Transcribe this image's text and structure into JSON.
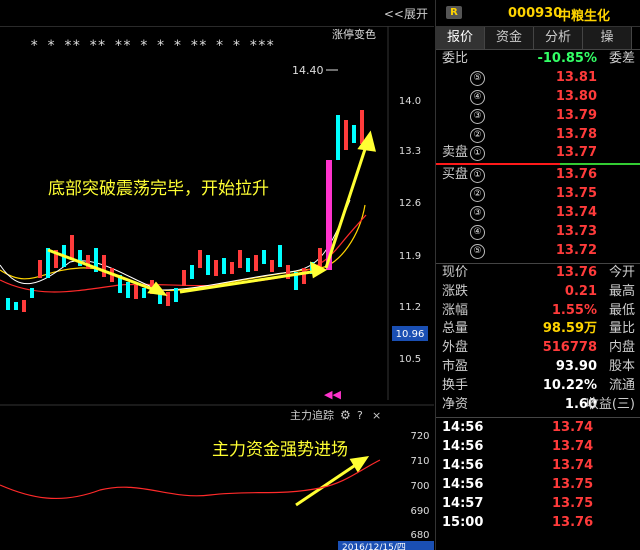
{
  "chart": {
    "expand_label": "<<展开",
    "limit_label": "涨停变色",
    "high_label": "14.40",
    "annotation_1": "底部突破震荡完毕，开始拉升",
    "annotation_2": "主力资金强势进场",
    "sub_title": "主力追踪",
    "price_axis": [
      "14.0",
      "13.3",
      "12.6",
      "11.9",
      "11.2",
      "10.96",
      "10.5"
    ],
    "sub_axis": [
      "720",
      "710",
      "700",
      "690",
      "680"
    ],
    "date_label": "2016/12/15/四",
    "star_marks": "* *  ** **   **   * *  * **     *   * ***"
  },
  "header": {
    "badge": "R",
    "code": "000930",
    "name": "中粮生化"
  },
  "tabs": [
    "报价",
    "资金",
    "分析",
    "操"
  ],
  "weibi": {
    "label": "委比",
    "value": "-10.85%",
    "label2": "委差"
  },
  "sell": [
    {
      "num": "⑤",
      "price": "13.81"
    },
    {
      "num": "④",
      "price": "13.80"
    },
    {
      "num": "③",
      "price": "13.79"
    },
    {
      "num": "②",
      "price": "13.78"
    },
    {
      "num": "①",
      "price": "13.77",
      "label": "卖盘"
    }
  ],
  "buy": [
    {
      "num": "①",
      "price": "13.76",
      "label": "买盘"
    },
    {
      "num": "②",
      "price": "13.75"
    },
    {
      "num": "③",
      "price": "13.74"
    },
    {
      "num": "④",
      "price": "13.73"
    },
    {
      "num": "⑤",
      "price": "13.72"
    }
  ],
  "stats": [
    {
      "l": "现价",
      "v": "13.76",
      "r": "今开",
      "color": "#ff3b3b"
    },
    {
      "l": "涨跌",
      "v": "0.21",
      "r": "最高",
      "color": "#ff3b3b"
    },
    {
      "l": "涨幅",
      "v": "1.55%",
      "r": "最低",
      "color": "#ff3b3b"
    },
    {
      "l": "总量",
      "v": "98.59万",
      "r": "量比",
      "color": "#ffd400"
    },
    {
      "l": "外盘",
      "v": "516778",
      "r": "内盘",
      "color": "#ff3b3b"
    },
    {
      "l": "市盈",
      "v": "93.90",
      "r": "股本",
      "color": "#fff"
    },
    {
      "l": "换手",
      "v": "10.22%",
      "r": "流通",
      "color": "#fff"
    },
    {
      "l": "净资",
      "v": "1.60",
      "r": "收益(三)",
      "color": "#fff"
    }
  ],
  "ticks": [
    {
      "t": "14:56",
      "p": "13.74"
    },
    {
      "t": "14:56",
      "p": "13.74"
    },
    {
      "t": "14:56",
      "p": "13.74"
    },
    {
      "t": "14:56",
      "p": "13.75"
    },
    {
      "t": "14:57",
      "p": "13.75"
    },
    {
      "t": "15:00",
      "p": "13.76"
    }
  ],
  "colors": {
    "up": "#ff3b3b",
    "down": "#00ffff",
    "accent": "#ffd400",
    "volume_spike": "#ff33cc"
  }
}
